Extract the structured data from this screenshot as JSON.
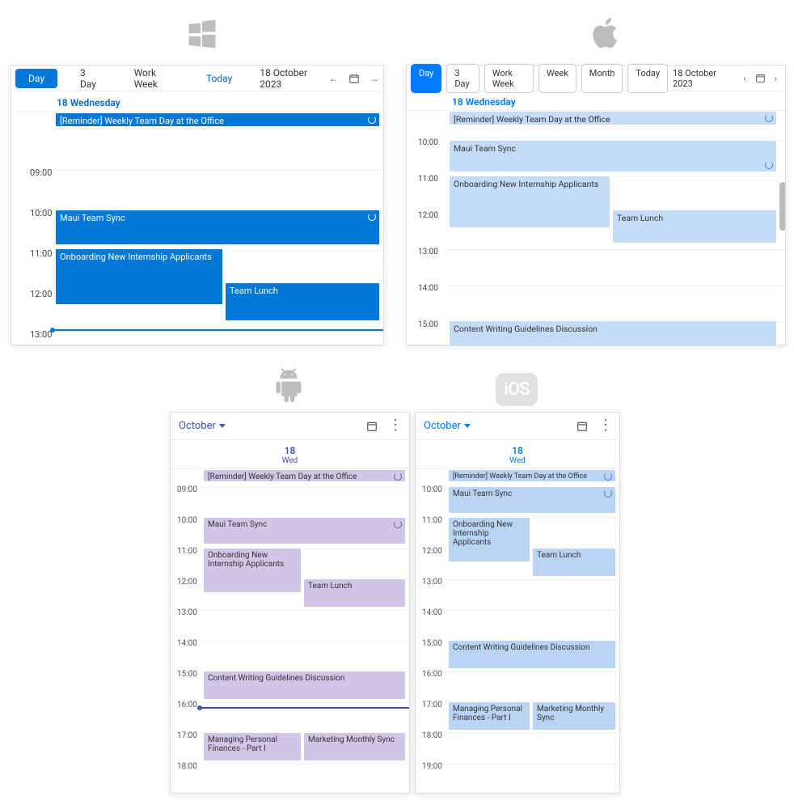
{
  "platforms": {
    "windows_icon": "windows",
    "mac_icon": "apple",
    "android_icon": "android",
    "ios_icon": "iOS"
  },
  "win": {
    "toolbar": {
      "day": "Day",
      "three_day": "3 Day",
      "work_week": "Work Week",
      "today": "Today",
      "date": "18 October 2023"
    },
    "day_header": "18 Wednesday",
    "times": [
      "09:00",
      "10:00",
      "11:00",
      "12:00",
      "13:00"
    ],
    "events": {
      "reminder": "[Reminder] Weekly Team Day at the Office",
      "maui": "Maui Team Sync",
      "onboarding": "Onboarding New Internship Applicants",
      "lunch": "Team Lunch"
    }
  },
  "mac": {
    "toolbar": {
      "day": "Day",
      "three_day": "3 Day",
      "work_week": "Work Week",
      "week": "Week",
      "month": "Month",
      "today": "Today",
      "date": "18 October 2023"
    },
    "day_header": "18 Wednesday",
    "times": [
      "10:00",
      "11:00",
      "12:00",
      "13:00",
      "14:00",
      "15:00"
    ],
    "events": {
      "reminder": "[Reminder] Weekly Team Day at the Office",
      "maui": "Maui Team Sync",
      "onboarding": "Onboarding New Internship Applicants",
      "lunch": "Team Lunch",
      "writing": "Content Writing Guidelines Discussion"
    }
  },
  "android": {
    "month": "October",
    "day_num": "18",
    "day_wk": "Wed",
    "times": [
      "09:00",
      "10:00",
      "11:00",
      "12:00",
      "13:00",
      "14:00",
      "15:00",
      "16:00",
      "17:00",
      "18:00"
    ],
    "events": {
      "reminder": "[Reminder] Weekly Team Day at the Office",
      "maui": "Maui Team Sync",
      "onboarding": "Onboarding New Internship Applicants",
      "lunch": "Team Lunch",
      "writing": "Content Writing Guidelines Discussion",
      "finances": "Managing Personal Finances - Part I",
      "marketing": "Marketing Monthly Sync"
    }
  },
  "ios": {
    "month": "October",
    "day_num": "18",
    "day_wk": "Wed",
    "times": [
      "10:00",
      "11:00",
      "12:00",
      "13:00",
      "14:00",
      "15:00",
      "16:00",
      "17:00",
      "18:00",
      "19:00"
    ],
    "events": {
      "reminder": "[Reminder] Weekly Team Day at the Office",
      "maui": "Maui Team Sync",
      "onboarding": "Onboarding New Internship Applicants",
      "lunch": "Team Lunch",
      "writing": "Content Writing Guidelines Discussion",
      "finances": "Managing Personal Finances - Part I",
      "marketing": "Marketing Monthly Sync"
    }
  }
}
